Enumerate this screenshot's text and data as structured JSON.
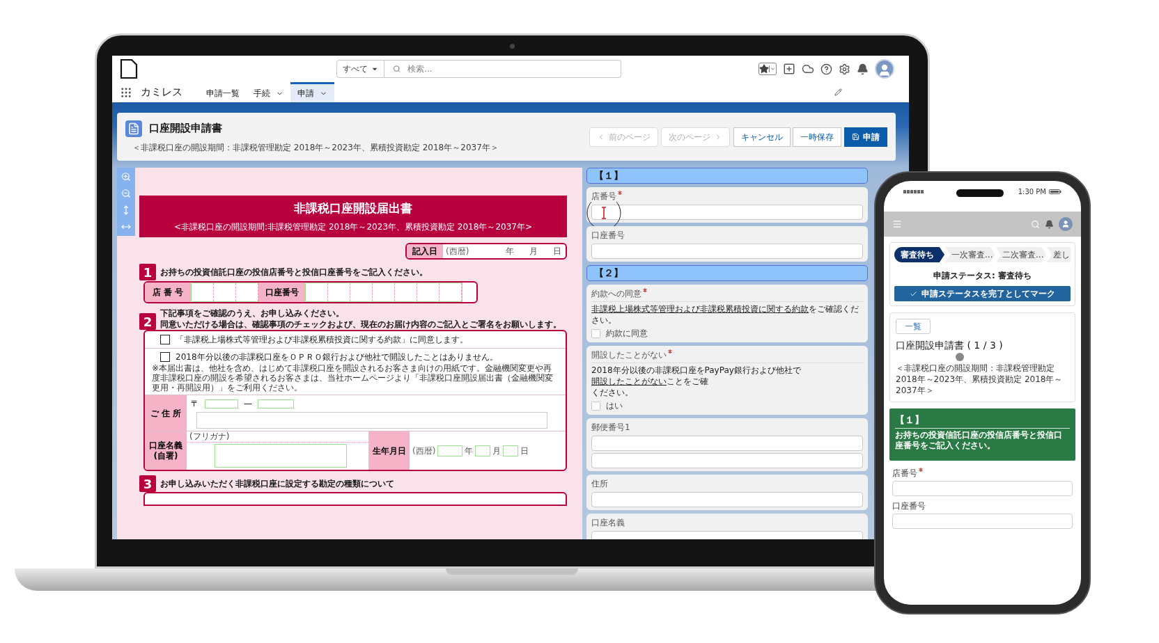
{
  "laptop": {
    "app_bar": {
      "search_scope": "すべて",
      "search_placeholder": "検索...",
      "app_name": "カミレス",
      "nav": [
        {
          "label": "申請一覧",
          "selected": false,
          "has_menu": false
        },
        {
          "label": "手続",
          "selected": false,
          "has_menu": true
        },
        {
          "label": "申請",
          "selected": true,
          "has_menu": true
        }
      ]
    },
    "page_header": {
      "title": "口座開設申請書",
      "subtitle": "＜非課税口座の開設期間：非課税管理勘定 2018年～2023年、累積投資勘定 2018年～2037年＞",
      "buttons": [
        {
          "kind": "prev",
          "label": "前のページ",
          "disabled": true
        },
        {
          "kind": "next",
          "label": "次のページ",
          "disabled": true
        },
        {
          "kind": "secondary",
          "label": "キャンセル",
          "disabled": false
        },
        {
          "kind": "secondary",
          "label": "一時保存",
          "disabled": false
        },
        {
          "kind": "primary",
          "label": "申請",
          "disabled": false
        }
      ]
    },
    "pdf": {
      "title": "非課税口座開設届出書",
      "subtitle": "<非課税口座の開設期間:非課税管理勘定 2018年～2023年、累積投資勘定 2018年～2037年>",
      "entry_date": {
        "label": "記入日",
        "era": "(西暦)",
        "units": [
          "年",
          "月",
          "日"
        ]
      },
      "section_1": {
        "number": "1",
        "heading": "お持ちの投資信託口座の投信店番号と投信口座番号をご記入ください。",
        "fields": [
          {
            "kind": "branch",
            "label": "店 番 号"
          },
          {
            "kind": "account",
            "label": "口座番号"
          }
        ]
      },
      "section_2": {
        "number": "2",
        "heading_lines": [
          "下記事項をご確認のうえ、お申し込みください。",
          "同意いただける場合は、確認事項のチェックおよび、現在のお届け内容のご記入とご署名をお願いします。"
        ],
        "checks": [
          {
            "text": "「非課税上場株式等管理および非課税累積投資に関する約款」に同意します。",
            "checked": false
          },
          {
            "text": "2018年分以後の非課税口座をＯＰＲＯ銀行および他社で開設したことはありません。",
            "checked": false
          }
        ],
        "note": "※本届出書は、他社を含め、はじめて非課税口座を開設されるお客さま向けの用紙です。金融機関変更や再度非課税口座の開設を希望されるお客さまは、当社ホームページより「非課税口座開設届出書（金融機関変更用・再開設用）」をご利用ください。",
        "address": {
          "label": "ご 住 所",
          "postal_mark": "〒",
          "separator": "—"
        },
        "name": {
          "label_lines": [
            "口座名義",
            "(自署)"
          ],
          "furigana": "(フリガナ)"
        },
        "birth": {
          "label": "生年月日",
          "era": "(西暦)",
          "units": [
            "年",
            "月",
            "日"
          ]
        }
      },
      "section_3": {
        "number": "3",
        "heading": "お申し込みいただく非課税口座に設定する勘定の種類について"
      }
    },
    "form": {
      "sections": [
        {
          "heading": "【１】",
          "fields": [
            {
              "kind": "text",
              "label": "店番号",
              "required": true,
              "cursor": true
            },
            {
              "kind": "text",
              "label": "口座番号",
              "required": false,
              "cursor": false
            }
          ]
        },
        {
          "heading": "【２】",
          "fields": [
            {
              "kind": "consent",
              "label": "約款への同意",
              "required": true,
              "link": "非課税上場株式等管理および非課税累積投資に関する約款",
              "text_after": "をご確認ください。",
              "check_label": "約款に同意",
              "checked": false
            },
            {
              "kind": "consent",
              "label": "開設したことがない",
              "required": true,
              "text_before": "2018年分以後の非課税口座をPayPay銀行および他社で",
              "link": "開設したことがない",
              "text_after": "ことをご確",
              "text_next_line": "ください。",
              "check_label": "はい",
              "checked": false
            },
            {
              "kind": "double",
              "label": "郵便番号1",
              "required": false
            },
            {
              "kind": "text",
              "label": "住所",
              "required": false,
              "cursor": false
            },
            {
              "kind": "text",
              "label": "口座名義",
              "required": false,
              "cursor": false
            }
          ]
        }
      ]
    }
  },
  "phone": {
    "status_bar": {
      "time": "1:30 PM"
    },
    "path": [
      {
        "label": "審査待ち",
        "selected": true
      },
      {
        "label": "一次審査...",
        "selected": false
      },
      {
        "label": "二次審査...",
        "selected": false
      },
      {
        "label": "差し",
        "selected": false
      }
    ],
    "status_text": "申請ステータス: 審査待ち",
    "complete_button": "申請ステータスを完了としてマーク",
    "record": {
      "list_button": "一覧",
      "title": "口座開設申請書 ( 1 / 3 )",
      "subtitle": "＜非課税口座の開設期間：非課税管理勘定 2018年～2023年、累積投資勘定 2018年～2037年＞"
    },
    "section": {
      "heading": "【１】",
      "text": "お持ちの投資信託口座の投信店番号と投信口座番号をご記入ください。"
    },
    "fields": [
      {
        "label": "店番号",
        "required": true
      },
      {
        "label": "口座番号",
        "required": false
      }
    ]
  }
}
